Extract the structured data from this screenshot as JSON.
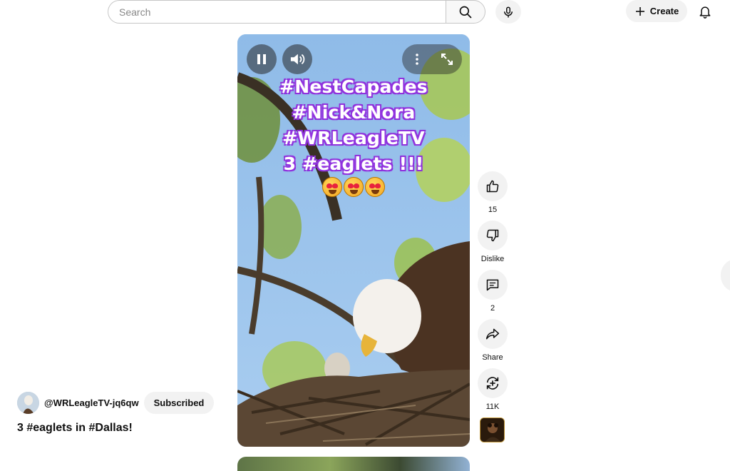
{
  "search": {
    "placeholder": "Search",
    "value": ""
  },
  "header": {
    "create_label": "Create"
  },
  "video": {
    "overlay_lines": [
      "#NestCapades",
      "#Nick&Nora",
      "#WRLeagleTV",
      "3 #eaglets !!!"
    ],
    "emoji_count": 3
  },
  "actions": {
    "like_count": "15",
    "dislike_label": "Dislike",
    "comment_count": "2",
    "share_label": "Share",
    "remix_count": "11K"
  },
  "channel": {
    "handle": "@WRLeagleTV-jq6qw",
    "subscribe_label": "Subscribed"
  },
  "short": {
    "title": "3 #eaglets in #Dallas!"
  },
  "icons": [
    "search-icon",
    "mic-icon",
    "plus-icon",
    "bell-icon",
    "pause-icon",
    "volume-icon",
    "more-vert-icon",
    "fullscreen-icon",
    "thumb-up-icon",
    "thumb-down-icon",
    "comment-icon",
    "share-icon",
    "remix-icon"
  ]
}
